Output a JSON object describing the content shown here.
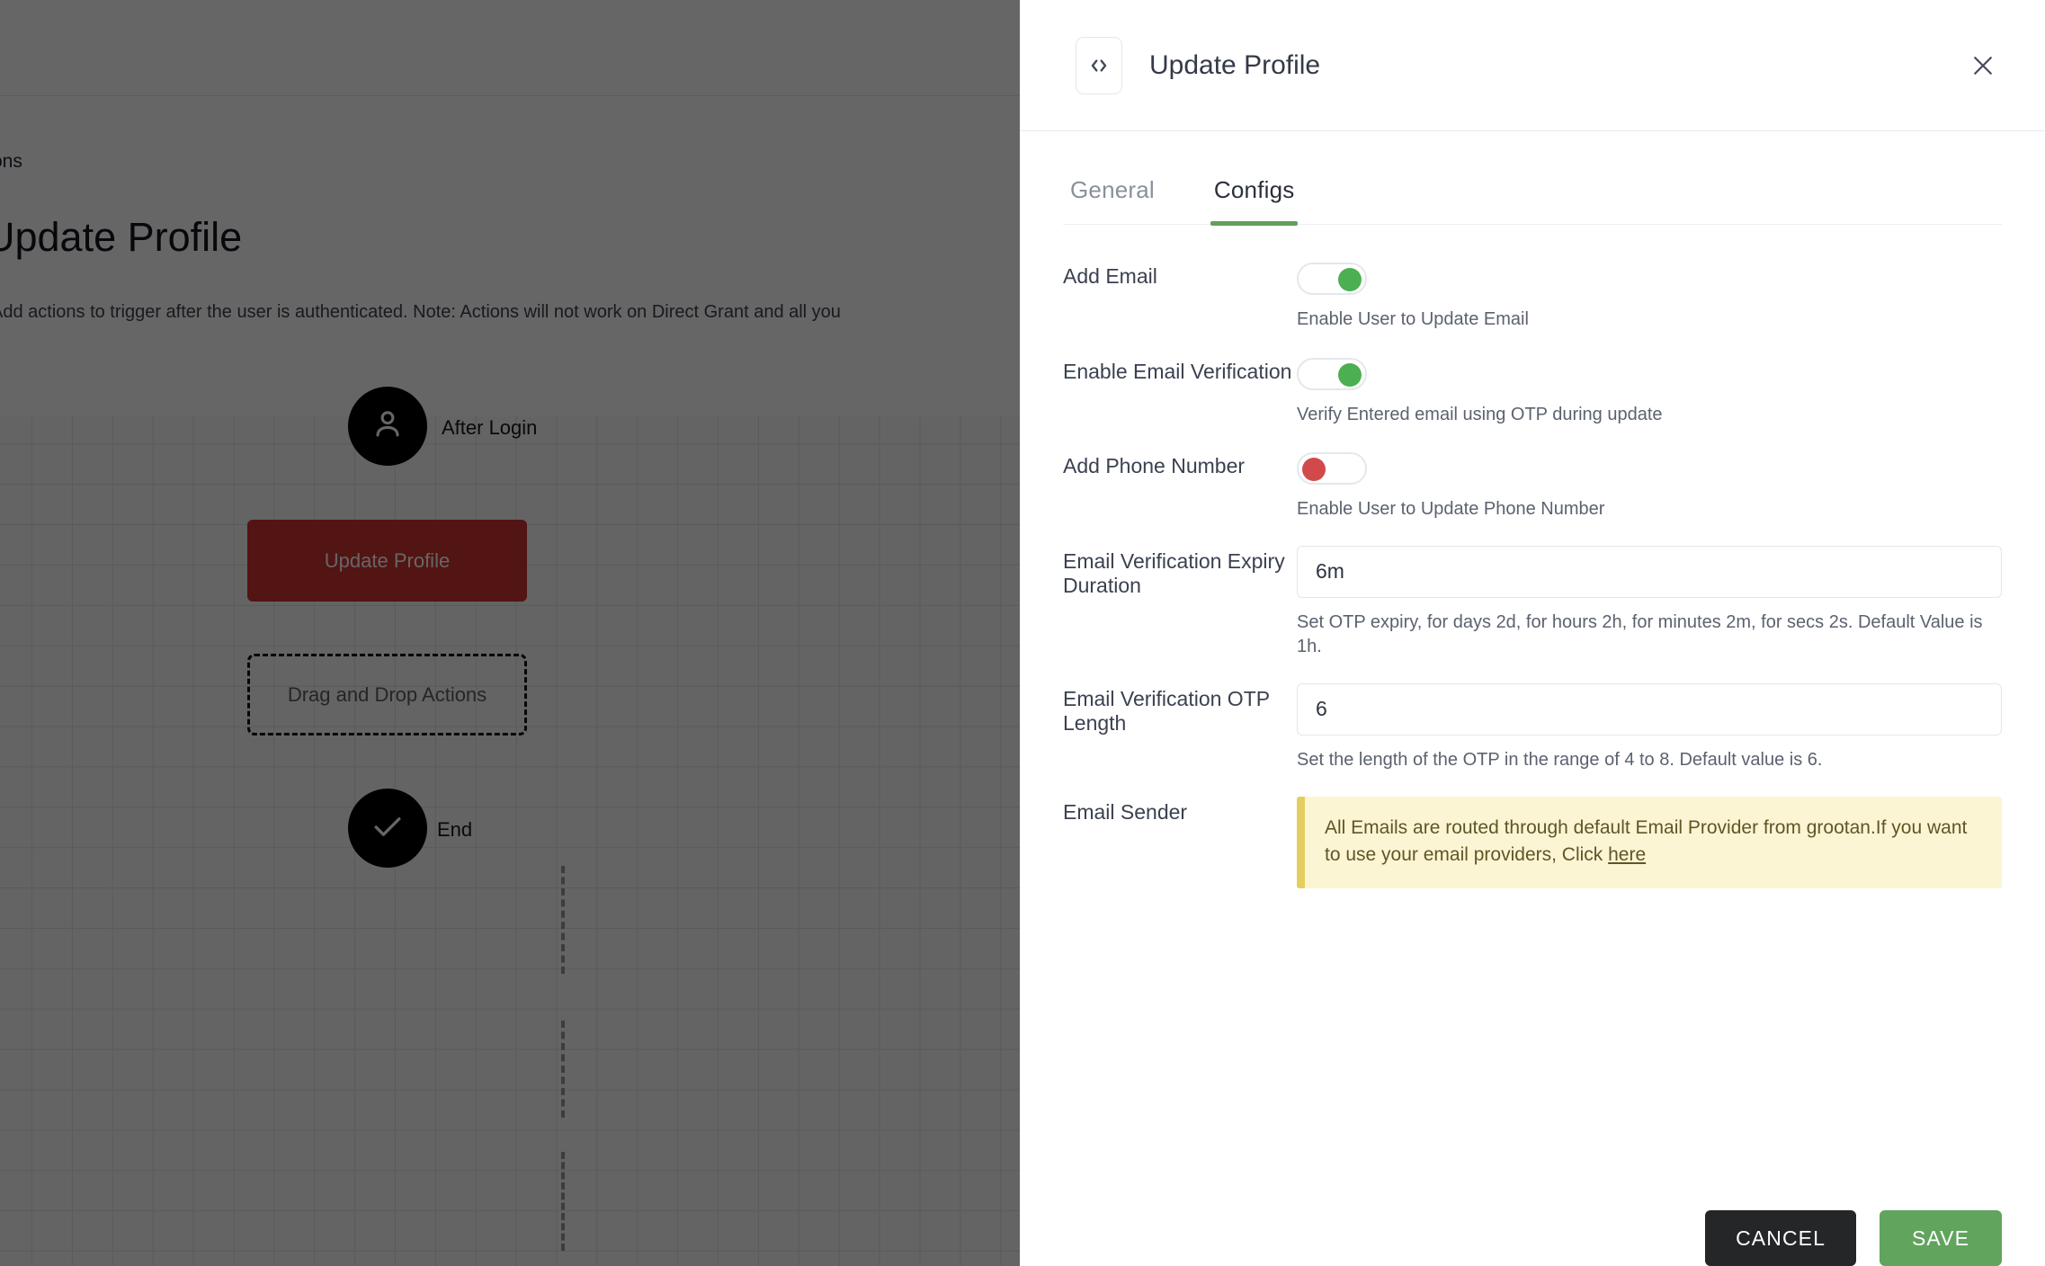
{
  "background": {
    "breadcrumb": "ctions",
    "title": "Update Profile",
    "subtitle": "Add actions to trigger after the user is authenticated. Note: Actions will not work on Direct Grant and all you",
    "flow": {
      "start_label": "After Login",
      "action_node_label": "Update Profile",
      "dropzone_label": "Drag and Drop Actions",
      "end_label": "End"
    }
  },
  "panel": {
    "title": "Update Profile",
    "code_icon": "code-brackets-icon",
    "close_icon": "close-icon",
    "tabs": [
      {
        "label": "General",
        "active": false
      },
      {
        "label": "Configs",
        "active": true
      }
    ],
    "fields": {
      "add_email": {
        "label": "Add Email",
        "toggle_state": "on",
        "hint": "Enable User to Update Email"
      },
      "enable_email_verification": {
        "label": "Enable Email Verification",
        "toggle_state": "on",
        "hint": "Verify Entered email using OTP during update"
      },
      "add_phone_number": {
        "label": "Add Phone Number",
        "toggle_state": "off",
        "hint": "Enable User to Update Phone Number"
      },
      "email_verification_expiry_duration": {
        "label": "Email Verification Expiry Duration",
        "value": "6m",
        "hint": "Set OTP expiry, for days 2d, for hours 2h, for minutes 2m, for secs 2s. Default Value is 1h."
      },
      "email_verification_otp_length": {
        "label": "Email Verification OTP Length",
        "value": "6",
        "hint": "Set the length of the OTP in the range of 4 to 8. Default value is 6."
      },
      "email_sender": {
        "label": "Email Sender",
        "warning_text": "All Emails are routed through default Email Provider from grootan.If you want to use your email providers, Click ",
        "warning_link": "here"
      }
    },
    "footer": {
      "cancel_label": "CANCEL",
      "save_label": "SAVE"
    }
  },
  "colors": {
    "toggle_on": "#4caf50",
    "toggle_off": "#d2494c",
    "tab_accent": "#5ea15a",
    "save_button": "#61a45d",
    "cancel_button": "#252628",
    "warning_bg": "#fcf5d4",
    "warning_border": "#e2cf5f",
    "action_node": "#cf3434"
  }
}
